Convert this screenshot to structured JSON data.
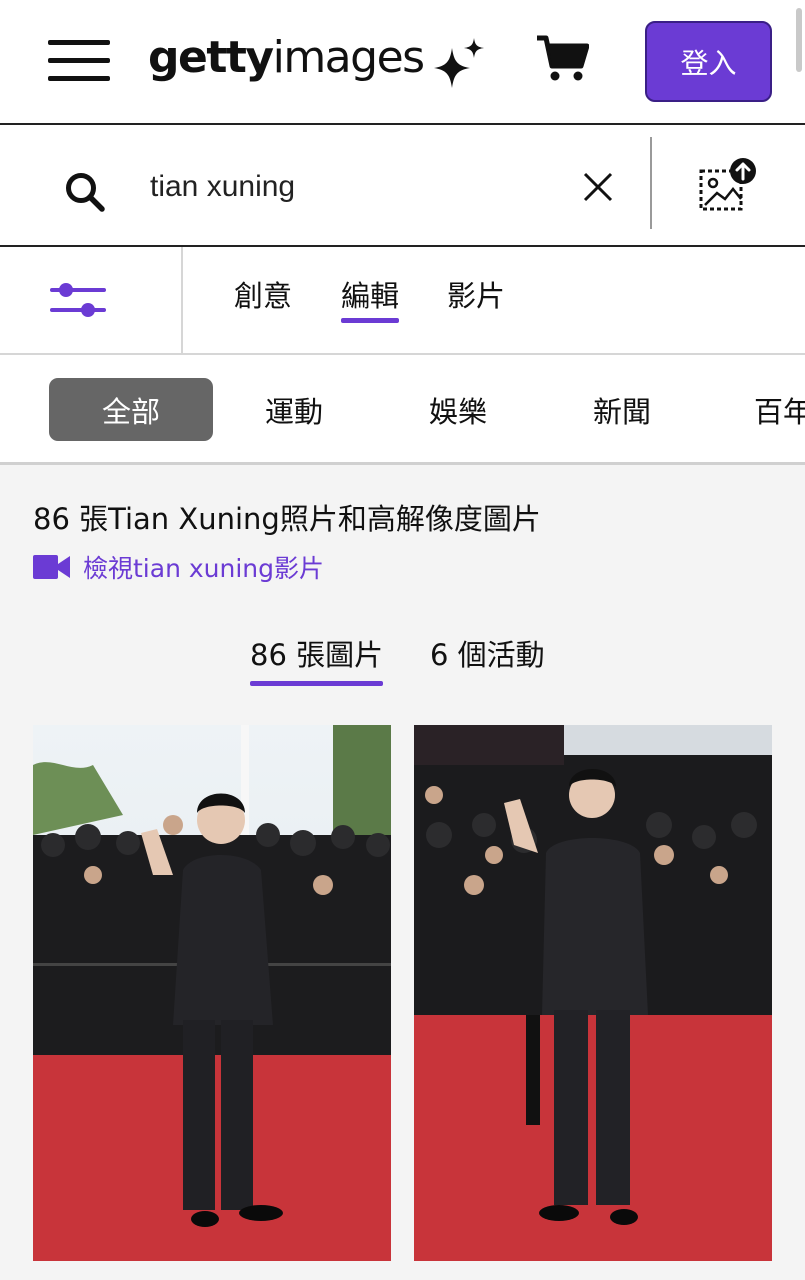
{
  "header": {
    "logo_bold": "getty",
    "logo_light": "images",
    "login_label": "登入"
  },
  "search": {
    "query": "tian xuning"
  },
  "content_tabs": [
    {
      "label": "創意",
      "active": false
    },
    {
      "label": "編輯",
      "active": true
    },
    {
      "label": "影片",
      "active": false
    }
  ],
  "categories": [
    {
      "label": "全部",
      "active": true
    },
    {
      "label": "運動",
      "active": false
    },
    {
      "label": "娛樂",
      "active": false
    },
    {
      "label": "新聞",
      "active": false
    },
    {
      "label": "百年",
      "active": false
    }
  ],
  "results": {
    "title": "86 張Tian Xuning照片和高解像度圖片",
    "video_link": "檢視tian xuning影片",
    "tabs": [
      {
        "label": "86 張圖片",
        "active": true
      },
      {
        "label": "6 個活動",
        "active": false
      }
    ]
  },
  "colors": {
    "accent": "#6b3bd4",
    "chip_active": "#666666",
    "carpet": "#c8343a"
  },
  "icons": [
    "menu-icon",
    "sparkle-icon",
    "cart-icon",
    "search-icon",
    "close-icon",
    "image-search-icon",
    "filter-icon",
    "video-icon"
  ]
}
